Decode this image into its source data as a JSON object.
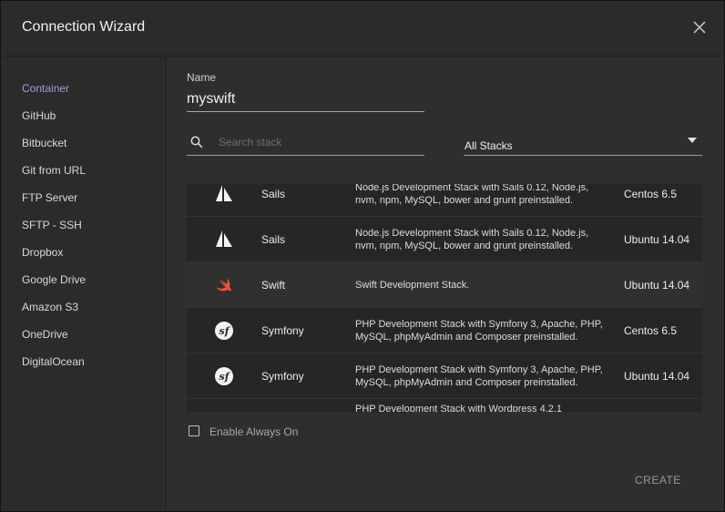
{
  "window": {
    "title": "Connection Wizard"
  },
  "sidebar": {
    "items": [
      {
        "label": "Container",
        "active": true
      },
      {
        "label": "GitHub"
      },
      {
        "label": "Bitbucket"
      },
      {
        "label": "Git from URL"
      },
      {
        "label": "FTP Server"
      },
      {
        "label": "SFTP - SSH"
      },
      {
        "label": "Dropbox"
      },
      {
        "label": "Google Drive"
      },
      {
        "label": "Amazon S3"
      },
      {
        "label": "OneDrive"
      },
      {
        "label": "DigitalOcean"
      }
    ]
  },
  "form": {
    "name_label": "Name",
    "name_value": "myswift",
    "search_placeholder": "Search stack",
    "stack_filter": "All Stacks"
  },
  "stacks": {
    "rows": [
      {
        "name": "Sails",
        "icon": "sails-icon",
        "description": "Node.js Development Stack with Sails 0.12, Node.js, nvm, npm, MySQL, bower and grunt preinstalled.",
        "os": "Centos 6.5"
      },
      {
        "name": "Sails",
        "icon": "sails-icon",
        "description": "Node.js Development Stack with Sails 0.12, Node.js, nvm, npm, MySQL, bower and grunt preinstalled.",
        "os": "Ubuntu 14.04"
      },
      {
        "name": "Swift",
        "icon": "swift-icon",
        "description": "Swift Development Stack.",
        "os": "Ubuntu 14.04",
        "selected": true
      },
      {
        "name": "Symfony",
        "icon": "symfony-icon",
        "description": "PHP Development Stack with Symfony 3, Apache, PHP, MySQL, phpMyAdmin and Composer preinstalled.",
        "os": "Centos 6.5"
      },
      {
        "name": "Symfony",
        "icon": "symfony-icon",
        "description": "PHP Development Stack with Symfony 3, Apache, PHP, MySQL, phpMyAdmin and Composer preinstalled.",
        "os": "Ubuntu 14.04"
      },
      {
        "name": "",
        "icon": "",
        "description": "PHP Development Stack with Wordpress 4.2.1",
        "os": ""
      }
    ]
  },
  "options": {
    "always_on_label": "Enable Always On",
    "always_on_checked": false
  },
  "actions": {
    "create_label": "CREATE"
  },
  "colors": {
    "active_sidebar": "#a79bd8",
    "swift_orange": "#f05138",
    "background": "#2b2b2b"
  }
}
